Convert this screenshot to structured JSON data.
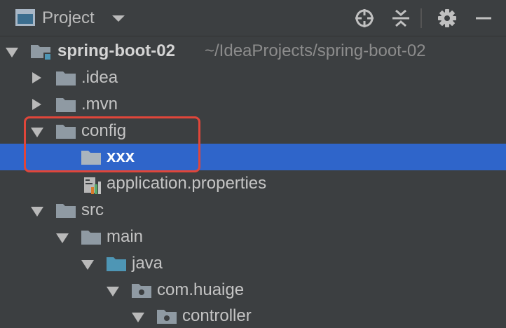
{
  "header": {
    "title": "Project",
    "icons": [
      "project-view-icon",
      "caret-down-icon",
      "locate-icon",
      "collapse-icon",
      "gear-icon",
      "minimize-icon"
    ]
  },
  "tree": {
    "root_name": "spring-boot-02",
    "root_path": "~/IdeaProjects/spring-boot-02",
    "items": {
      "idea": ".idea",
      "mvn": ".mvn",
      "config": "config",
      "xxx": "xxx",
      "app_props": "application.properties",
      "src": "src",
      "main": "main",
      "java": "java",
      "com_huaige": "com.huaige",
      "controller": "controller"
    }
  },
  "colors": {
    "background": "#3c3f41",
    "selection": "#2f65ca",
    "highlight_border": "#e0463a",
    "folder": "#8f9aa3",
    "source_folder": "#4e96b5"
  }
}
